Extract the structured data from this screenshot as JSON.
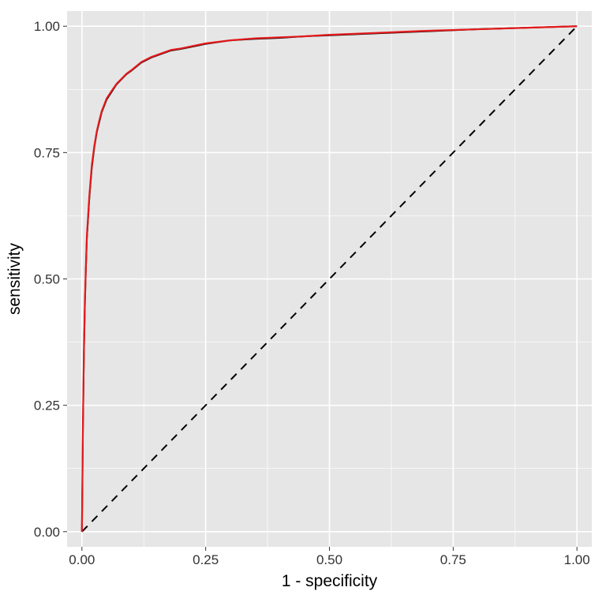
{
  "chart_data": {
    "type": "line",
    "title": "",
    "xlabel": "1 - specificity",
    "ylabel": "sensitivity",
    "xlim": [
      -0.03,
      1.03
    ],
    "ylim": [
      -0.03,
      1.03
    ],
    "x_ticks": [
      0.0,
      0.25,
      0.5,
      0.75,
      1.0
    ],
    "y_ticks": [
      0.0,
      0.25,
      0.5,
      0.75,
      1.0
    ],
    "x_tick_labels": [
      "0.00",
      "0.25",
      "0.50",
      "0.75",
      "1.00"
    ],
    "y_tick_labels": [
      "0.00",
      "0.25",
      "0.50",
      "0.75",
      "1.00"
    ],
    "series": [
      {
        "name": "ROC curve (black)",
        "color": "#000000",
        "x": [
          0.0,
          0.002,
          0.004,
          0.006,
          0.008,
          0.01,
          0.015,
          0.02,
          0.025,
          0.03,
          0.035,
          0.04,
          0.05,
          0.06,
          0.07,
          0.08,
          0.09,
          0.1,
          0.12,
          0.14,
          0.16,
          0.18,
          0.2,
          0.25,
          0.3,
          0.35,
          0.4,
          0.45,
          0.5,
          0.6,
          0.7,
          0.8,
          0.9,
          1.0
        ],
        "y": [
          0.0,
          0.2,
          0.35,
          0.45,
          0.52,
          0.58,
          0.66,
          0.72,
          0.76,
          0.79,
          0.81,
          0.83,
          0.855,
          0.87,
          0.885,
          0.895,
          0.905,
          0.912,
          0.928,
          0.938,
          0.945,
          0.952,
          0.955,
          0.965,
          0.972,
          0.975,
          0.977,
          0.98,
          0.982,
          0.986,
          0.99,
          0.994,
          0.997,
          1.0
        ]
      },
      {
        "name": "ROC curve (red)",
        "color": "#e41a1c",
        "x": [
          0.0,
          0.002,
          0.004,
          0.006,
          0.008,
          0.01,
          0.015,
          0.02,
          0.025,
          0.03,
          0.035,
          0.04,
          0.05,
          0.06,
          0.07,
          0.08,
          0.09,
          0.1,
          0.12,
          0.14,
          0.16,
          0.18,
          0.2,
          0.25,
          0.3,
          0.35,
          0.4,
          0.45,
          0.5,
          0.6,
          0.7,
          0.8,
          0.9,
          1.0
        ],
        "y": [
          0.0,
          0.21,
          0.36,
          0.455,
          0.525,
          0.585,
          0.665,
          0.725,
          0.763,
          0.792,
          0.813,
          0.832,
          0.857,
          0.872,
          0.886,
          0.896,
          0.906,
          0.913,
          0.929,
          0.939,
          0.946,
          0.953,
          0.956,
          0.966,
          0.972,
          0.976,
          0.978,
          0.98,
          0.983,
          0.987,
          0.991,
          0.994,
          0.997,
          1.0
        ]
      },
      {
        "name": "Reference (y = x)",
        "color": "#000000",
        "dashed": true,
        "x": [
          0.0,
          1.0
        ],
        "y": [
          0.0,
          1.0
        ]
      }
    ],
    "grid": {
      "major_step": 0.25
    },
    "legend": false
  },
  "colors": {
    "panel": "#e6e6e6",
    "grid": "#ffffff",
    "red": "#e41a1c",
    "black": "#000000"
  }
}
